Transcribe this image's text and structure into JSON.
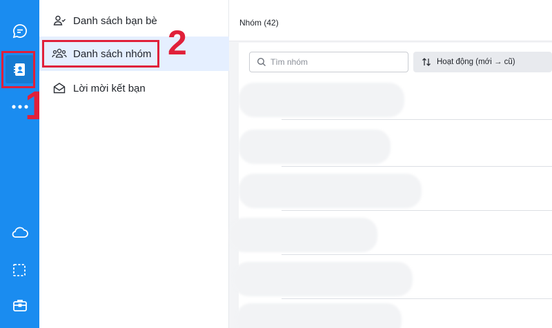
{
  "rail": {
    "accent_color": "#1a8cf0",
    "items": [
      {
        "icon": "chat-bubble-icon"
      },
      {
        "icon": "contacts-book-icon",
        "active": true
      },
      {
        "icon": "more-dots-icon"
      },
      {
        "icon": "cloud-icon"
      },
      {
        "icon": "screenshot-crop-icon"
      },
      {
        "icon": "briefcase-icon"
      }
    ]
  },
  "annotations": {
    "step_1": "1",
    "step_2": "2",
    "highlight_color": "#e0203a"
  },
  "sidebar": {
    "items": [
      {
        "label": "Danh sách bạn bè",
        "icon": "friends-icon"
      },
      {
        "label": "Danh sách nhóm",
        "icon": "group-icon",
        "active": true
      },
      {
        "label": "Lời mời kết bạn",
        "icon": "envelope-icon"
      }
    ]
  },
  "main": {
    "title": "Nhóm (42)",
    "search": {
      "placeholder": "Tìm nhóm"
    },
    "sort": {
      "label": "Hoạt động (mới → cũ)",
      "icon": "sort-arrows-icon"
    }
  }
}
